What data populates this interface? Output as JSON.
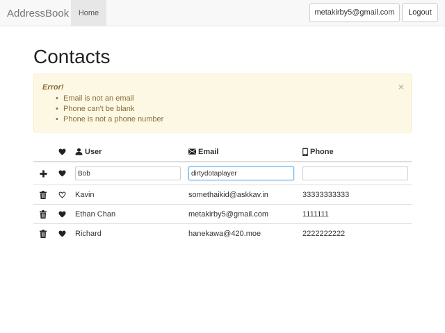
{
  "navbar": {
    "brand": "AddressBook",
    "home_label": "Home",
    "user_email": "metakirby5@gmail.com",
    "logout_label": "Logout"
  },
  "page": {
    "title": "Contacts"
  },
  "alert": {
    "title": "Error!",
    "close_glyph": "×",
    "messages": [
      "Email is not an email",
      "Phone can't be blank",
      "Phone is not a phone number"
    ]
  },
  "table": {
    "headers": {
      "user": "User",
      "email": "Email",
      "phone": "Phone"
    },
    "new_row": {
      "user_value": "Bob",
      "email_value": "dirtydotaplayer",
      "phone_value": ""
    },
    "rows": [
      {
        "user": "Kavin",
        "email": "somethaikid@askkav.in",
        "phone": "33333333333",
        "favorite": false
      },
      {
        "user": "Ethan Chan",
        "email": "metakirby5@gmail.com",
        "phone": "1111111",
        "favorite": true
      },
      {
        "user": "Richard",
        "email": "hanekawa@420.moe",
        "phone": "2222222222",
        "favorite": true
      }
    ]
  },
  "icons": {
    "add": "plus-icon",
    "delete": "trash-icon",
    "favorite": "heart-icon",
    "favorite_empty": "heart-outline-icon",
    "user": "user-icon",
    "email": "envelope-icon",
    "phone": "phone-icon",
    "close": "close-icon"
  },
  "colors": {
    "alert_bg": "#fcf8e3",
    "alert_text": "#8a6d3b",
    "navbar_bg": "#f8f8f8",
    "input_focus": "#66afe9"
  }
}
